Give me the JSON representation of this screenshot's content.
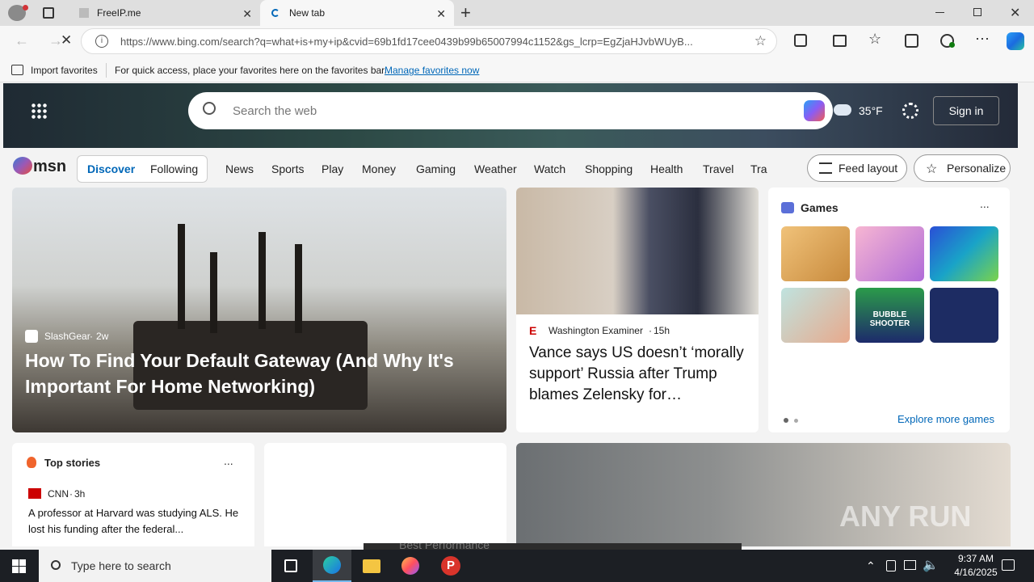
{
  "browser": {
    "tabs": [
      {
        "title": "FreeIP.me"
      },
      {
        "title": "New tab"
      }
    ],
    "url": "https://www.bing.com/search?q=what+is+my+ip&cvid=69b1fd17cee0439b99b65007994c1152&gs_lcrp=EgZjaHJvbWUyB...",
    "favorites_bar": {
      "import_label": "Import favorites",
      "hint": "For quick access, place your favorites here on the favorites bar.",
      "manage_link": "Manage favorites now"
    }
  },
  "msn": {
    "search_placeholder": "Search the web",
    "temperature": "35°F",
    "sign_in": "Sign in",
    "logo_text": "msn",
    "feed_tabs": [
      "Discover",
      "Following"
    ],
    "nav": [
      "News",
      "Sports",
      "Play",
      "Money",
      "Gaming",
      "Weather",
      "Watch",
      "Shopping",
      "Health",
      "Travel",
      "Tra"
    ],
    "feed_layout": "Feed layout",
    "personalize": "Personalize",
    "hero_article": {
      "source": "SlashGear",
      "age": "2w",
      "title": "How To Find Your Default Gateway (And Why It's Important For Home Networking)"
    },
    "side_article": {
      "source": "Washington Examiner",
      "age": "15h",
      "title": "Vance says US doesn’t ‘morally support’ Russia after Trump blames Zelensky for…"
    },
    "games": {
      "title": "Games",
      "more": "...",
      "explore": "Explore more games",
      "tile_bubble": "BUBBLE SHOOTER"
    },
    "top_stories": {
      "title": "Top stories",
      "more": "...",
      "source": "CNN",
      "age": "3h",
      "headline": "A professor at Harvard was studying ALS. He lost his funding after the federal..."
    },
    "watermark": "ANY RUN",
    "overlay_text": "Best Performance"
  },
  "taskbar": {
    "search_placeholder": "Type here to search",
    "time": "9:37 AM",
    "date": "4/16/2025"
  }
}
